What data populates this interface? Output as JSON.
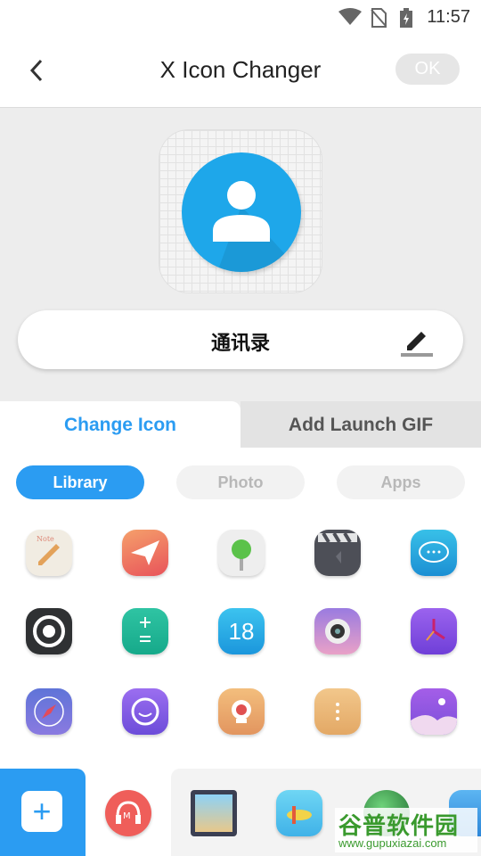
{
  "status_bar": {
    "time": "11:57"
  },
  "header": {
    "title": "X Icon Changer",
    "ok_label": "OK"
  },
  "preview": {
    "icon_name": "contacts-icon"
  },
  "name_field": {
    "value": "通讯录"
  },
  "tabs": [
    {
      "label": "Change Icon",
      "active": true
    },
    {
      "label": "Add Launch GIF",
      "active": false
    }
  ],
  "segments": [
    {
      "label": "Library",
      "active": true
    },
    {
      "label": "Photo",
      "active": false
    },
    {
      "label": "Apps",
      "active": false
    }
  ],
  "library_icons": [
    "notes-icon",
    "paper-plane-icon",
    "lollipop-icon",
    "clapperboard-icon",
    "chat-bubble-icon",
    "camera-lens-icon",
    "calculator-icon",
    "calendar-18-icon",
    "camera-icon",
    "clock-icon",
    "compass-icon",
    "smile-icon",
    "stamp-icon",
    "dots-icon",
    "mountain-gallery-icon"
  ],
  "calendar_day": "18",
  "bottom_bar": {
    "add_label": "+",
    "apps": [
      "music-icon",
      "gallery-frame-icon",
      "airplane-game-icon",
      "globe-icon",
      "blue-app-icon"
    ]
  },
  "watermark": {
    "main": "谷普软件园",
    "url": "www.gupuxiazai.com"
  },
  "colors": {
    "accent": "#2b9cf2",
    "contact_blue": "#1ea7ea",
    "watermark_green": "#3a9a2e"
  }
}
